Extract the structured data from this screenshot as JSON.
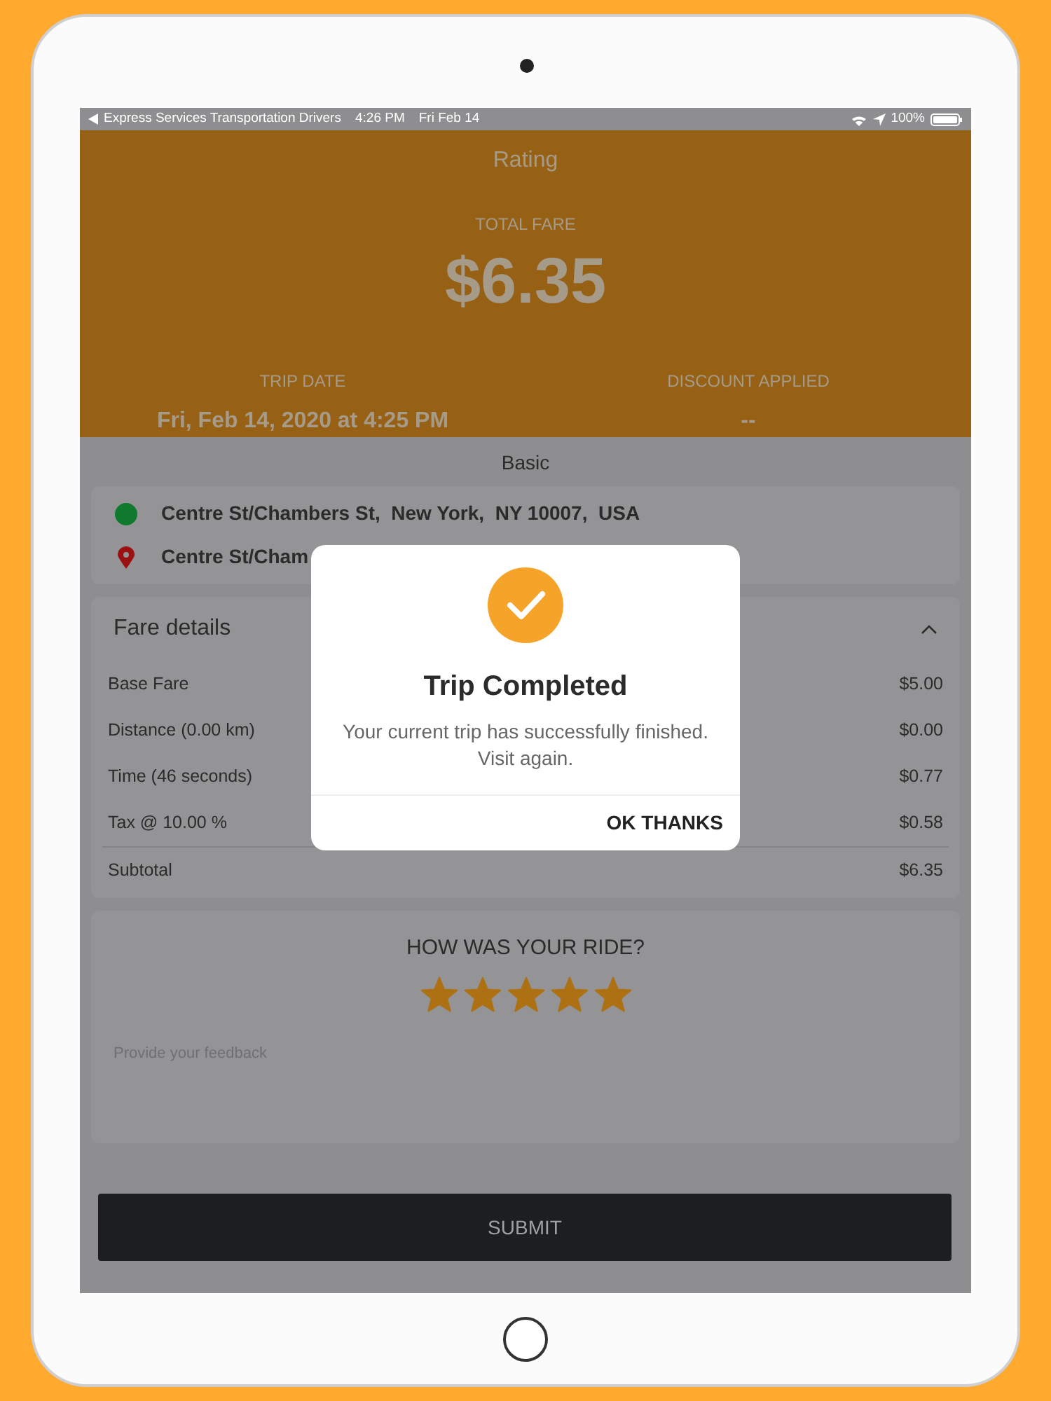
{
  "status_bar": {
    "back_app": "Express Services Transportation Drivers",
    "time": "4:26 PM",
    "date": "Fri Feb 14",
    "battery": "100%"
  },
  "header": {
    "title": "Rating",
    "total_label": "TOTAL FARE",
    "total": "$6.35",
    "trip_date_label": "TRIP DATE",
    "trip_date": "Fri, Feb 14, 2020 at 4:25 PM",
    "discount_label": "DISCOUNT APPLIED",
    "discount": "--"
  },
  "section_title": "Basic",
  "route": [
    {
      "kind": "pickup",
      "address": "Centre St/Chambers St,  New York,  NY 10007,  USA"
    },
    {
      "kind": "dropoff",
      "address": "Centre St/Cham"
    }
  ],
  "fare_details": {
    "title": "Fare details",
    "expanded": true,
    "rows": [
      {
        "kind": "item",
        "label": "Base Fare",
        "amount": "$5.00"
      },
      {
        "kind": "item",
        "label": "Distance (0.00 km)",
        "amount": "$0.00"
      },
      {
        "kind": "item",
        "label": "Time (46 seconds)",
        "amount": "$0.77"
      },
      {
        "kind": "item",
        "label": "Tax @ 10.00 %",
        "amount": "$0.58"
      },
      {
        "kind": "subtotal",
        "label": "Subtotal",
        "amount": "$6.35"
      }
    ]
  },
  "feedback": {
    "question": "HOW WAS YOUR RIDE?",
    "stars": 5,
    "placeholder": "Provide your feedback"
  },
  "submit": "SUBMIT",
  "dialog": {
    "title": "Trip Completed",
    "message": "Your current trip has successfully finished. Visit again.",
    "button": "OK THANKS"
  }
}
